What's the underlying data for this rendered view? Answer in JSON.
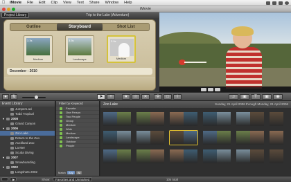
{
  "menubar": {
    "items": [
      "iMovie",
      "File",
      "Edit",
      "Clip",
      "View",
      "Text",
      "Share",
      "Window",
      "Help"
    ]
  },
  "window": {
    "title": "iMovie"
  },
  "project_library": {
    "button": "Project Library",
    "project_title": "Trip to the Lake (Adventure)",
    "tabs": [
      "Outline",
      "Storyboard",
      "Shot List"
    ],
    "active_tab": "Storyboard",
    "cards": [
      {
        "duration": "3.3s",
        "label": "Medium"
      },
      {
        "duration": "3.5s",
        "label": "Landscape"
      },
      {
        "duration": "3.0s",
        "label": "Medium"
      }
    ],
    "section_label": "December - 2010"
  },
  "event_library": {
    "header": "Event Library",
    "rows": [
      {
        "label": "Jumpers.avi",
        "year": false
      },
      {
        "label": "Todd Tropical",
        "year": false
      },
      {
        "label": "2008",
        "year": true
      },
      {
        "label": "Grand Canyon",
        "year": false
      },
      {
        "label": "2006",
        "year": true
      },
      {
        "label": "Zoo Lake",
        "year": false,
        "selected": true
      },
      {
        "label": "Return to the Zoo",
        "year": false
      },
      {
        "label": "Auckland Zoo",
        "year": false
      },
      {
        "label": "La Mer",
        "year": false
      },
      {
        "label": "Scuba Diving",
        "year": false
      },
      {
        "label": "2007",
        "year": true
      },
      {
        "label": "Snowboarding",
        "year": false
      },
      {
        "label": "2002",
        "year": true
      },
      {
        "label": "Longshots 2002",
        "year": false
      }
    ]
  },
  "keyword_filter": {
    "header": "Filter by Keyword",
    "keywords": [
      "Favorite",
      "One Person",
      "Two People",
      "Group",
      "Medium",
      "Wide",
      "Medium",
      "Landscape",
      "Outdoor",
      "People"
    ],
    "match_label": "Match",
    "match_options": [
      "Any",
      "All"
    ],
    "match_selected": "Any"
  },
  "browser": {
    "event_name": "Zoo Lake",
    "date_range": "Sunday, 21 April 2006 through Monday, 21 April 2006"
  },
  "status": {
    "show_label": "Show:",
    "show_value": "Favorites and Unmarked",
    "total": "10s total"
  },
  "colors": {
    "accent_selection": "#e4c22f",
    "selected_row": "#4a6c9b",
    "shelf": "#c6b994"
  }
}
